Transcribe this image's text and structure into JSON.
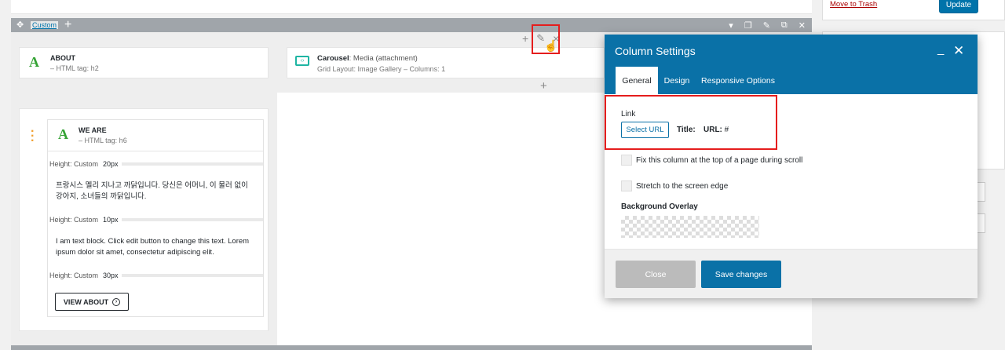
{
  "sidebar": {
    "move_to_trash": "Move to Trash",
    "update_label": "Update"
  },
  "row": {
    "custom_label": "Custom",
    "add_icon": "plus-icon",
    "toolbar_icons": [
      "chevron-down-icon",
      "copy-icon",
      "pencil-icon",
      "clone-icon",
      "close-icon"
    ]
  },
  "column_controls": {
    "add": "+",
    "edit_icon": "pencil-icon",
    "delete": "×",
    "add_element": "+"
  },
  "about_element": {
    "title": "ABOUT",
    "subtitle": "– HTML tag: h2"
  },
  "carousel_element": {
    "title_bold": "Carousel",
    "title_rest": ": Media (attachment)",
    "subtitle": "Grid Layout: Image Gallery – Columns: 1"
  },
  "inner": {
    "weare_title": "WE ARE",
    "weare_subtitle": "– HTML tag: h6",
    "spacer1_label": "Height: Custom",
    "spacer1_value": "20px",
    "korean_text": "프랑시스 멜리 지나고 까닭입니다. 당신은 어머니, 이 물러 없이 강아지, 소녀들의 까닭입니다.",
    "spacer2_label": "Height: Custom",
    "spacer2_value": "10px",
    "lorem_text": "I am text block. Click edit button to change this text. Lorem ipsum dolor sit amet, consectetur adipiscing elit.",
    "spacer3_label": "Height: Custom",
    "spacer3_value": "30px",
    "button_label": "VIEW ABOUT",
    "button_icon": "circle-arrow-right-icon"
  },
  "modal": {
    "title": "Column Settings",
    "tabs": [
      "General",
      "Design",
      "Responsive Options"
    ],
    "link_label": "Link",
    "select_url": "Select URL",
    "title_label": "Title:",
    "url_label": "URL:",
    "url_value": "#",
    "fix_label": "Fix this column at the top of a page during scroll",
    "stretch_label": "Stretch to the screen edge",
    "overlay_label": "Background Overlay",
    "close_label": "Close",
    "save_label": "Save changes"
  },
  "colors": {
    "accent": "#0a71a7",
    "highlight": "#e51d1d",
    "element_icon": "#35a335"
  }
}
